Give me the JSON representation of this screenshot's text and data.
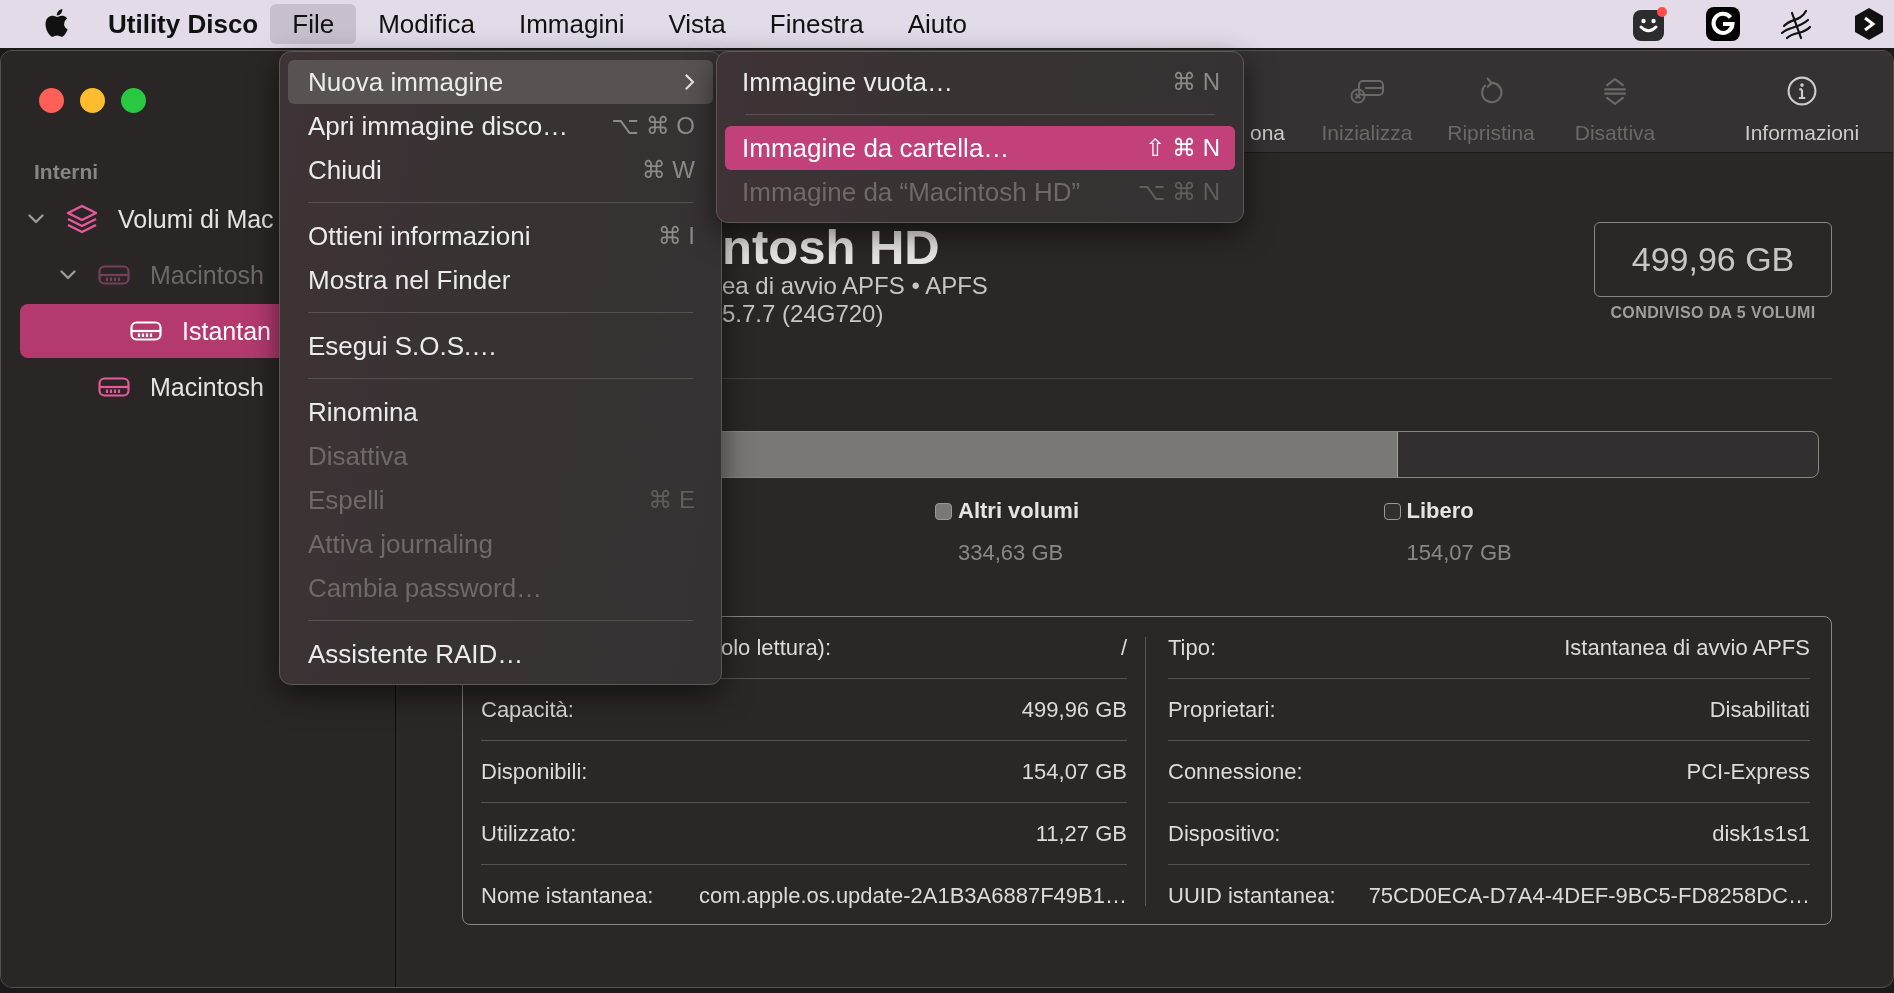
{
  "menu_bar": {
    "app_name": "Utility Disco",
    "menus": [
      {
        "label": "File",
        "selected": true
      },
      {
        "label": "Modifica",
        "selected": false
      },
      {
        "label": "Immagini",
        "selected": false
      },
      {
        "label": "Vista",
        "selected": false
      },
      {
        "label": "Finestra",
        "selected": false
      },
      {
        "label": "Aiuto",
        "selected": false
      }
    ]
  },
  "file_menu": {
    "items": [
      {
        "kind": "submenu",
        "label": "Nuova immagine",
        "selected": true,
        "disabled": false
      },
      {
        "kind": "item",
        "label": "Apri immagine disco…",
        "shortcut": "⌥ ⌘ O",
        "selected": false,
        "disabled": false
      },
      {
        "kind": "item",
        "label": "Chiudi",
        "shortcut": "⌘ W",
        "selected": false,
        "disabled": false
      },
      {
        "kind": "separator"
      },
      {
        "kind": "item",
        "label": "Ottieni informazioni",
        "shortcut": "⌘ I",
        "selected": false,
        "disabled": false
      },
      {
        "kind": "item",
        "label": "Mostra nel Finder",
        "selected": false,
        "disabled": false
      },
      {
        "kind": "separator"
      },
      {
        "kind": "item",
        "label": "Esegui S.O.S.…",
        "selected": false,
        "disabled": false
      },
      {
        "kind": "separator"
      },
      {
        "kind": "item",
        "label": "Rinomina",
        "selected": false,
        "disabled": false
      },
      {
        "kind": "item",
        "label": "Disattiva",
        "selected": false,
        "disabled": true
      },
      {
        "kind": "item",
        "label": "Espelli",
        "shortcut": "⌘ E",
        "selected": false,
        "disabled": true
      },
      {
        "kind": "item",
        "label": "Attiva journaling",
        "selected": false,
        "disabled": true
      },
      {
        "kind": "item",
        "label": "Cambia password…",
        "selected": false,
        "disabled": true
      },
      {
        "kind": "separator"
      },
      {
        "kind": "item",
        "label": "Assistente RAID…",
        "selected": false,
        "disabled": false
      }
    ]
  },
  "new_image_submenu": {
    "items": [
      {
        "kind": "item",
        "label": "Immagine vuota…",
        "shortcut": "⌘ N",
        "selected": false,
        "disabled": false
      },
      {
        "kind": "separator"
      },
      {
        "kind": "item",
        "label": "Immagine da cartella…",
        "shortcut": "⇧ ⌘ N",
        "selected": true,
        "disabled": false
      },
      {
        "kind": "item",
        "label": "Immagine da “Macintosh HD”",
        "shortcut": "⌥ ⌘ N",
        "selected": false,
        "disabled": true
      }
    ]
  },
  "sidebar": {
    "section": "Interni",
    "items": [
      {
        "label": "Volumi di Mac",
        "kind": "container",
        "expanded": true,
        "disabled": false,
        "selected": false,
        "children": [
          {
            "label": "Macintosh",
            "kind": "volume",
            "expanded": true,
            "disabled": true,
            "selected": false,
            "children": [
              {
                "label": "Istantan",
                "kind": "volume",
                "expanded": false,
                "disabled": false,
                "selected": true
              }
            ]
          },
          {
            "label": "Macintosh",
            "kind": "volume",
            "expanded": false,
            "disabled": false,
            "selected": false
          }
        ]
      }
    ]
  },
  "toolbar": {
    "items": [
      {
        "label": "ona",
        "kind": "partition",
        "disabled": false
      },
      {
        "label": "Inizializza",
        "kind": "erase",
        "disabled": true
      },
      {
        "label": "Ripristina",
        "kind": "restore",
        "disabled": true
      },
      {
        "label": "Disattiva",
        "kind": "unmount",
        "disabled": true
      },
      {
        "label": "Informazioni",
        "kind": "info",
        "disabled": false
      }
    ]
  },
  "volume": {
    "title": "ntosh HD",
    "subtitle": "ea di avvio APFS • APFS",
    "version": "5.7.7 (24G720)",
    "capacity": "499,96 GB",
    "capacity_note": "CONDIVISO DA 5 VOLUMI",
    "usage_bar": {
      "level": 0.69
    },
    "legend": [
      {
        "label": "Altri volumi",
        "value": "334,63 GB",
        "color": "#7a7876"
      },
      {
        "label": "Libero",
        "value": "154,07 GB",
        "color": "#332e2f"
      }
    ],
    "details": {
      "columns": [
        {
          "rows": [
            {
              "label": "olo lettura):",
              "value": "/"
            },
            {
              "label": "Capacità:",
              "value": "499,96 GB"
            },
            {
              "label": "Disponibili:",
              "value": "154,07 GB"
            },
            {
              "label": "Utilizzato:",
              "value": "11,27 GB"
            },
            {
              "label": "Nome istantanea:",
              "value": "com.apple.os.update-2A1B3A6887F49B1…"
            }
          ]
        },
        {
          "rows": [
            {
              "label": "Tipo:",
              "value": "Istantanea di avvio APFS"
            },
            {
              "label": "Proprietari:",
              "value": "Disabilitati"
            },
            {
              "label": "Connessione:",
              "value": "PCI-Express"
            },
            {
              "label": "Dispositivo:",
              "value": "disk1s1s1"
            },
            {
              "label": "UUID istantanea:",
              "value": "75CD0ECA-D7A4-4DEF-9BC5-FD8258DC…"
            }
          ]
        }
      ]
    }
  }
}
